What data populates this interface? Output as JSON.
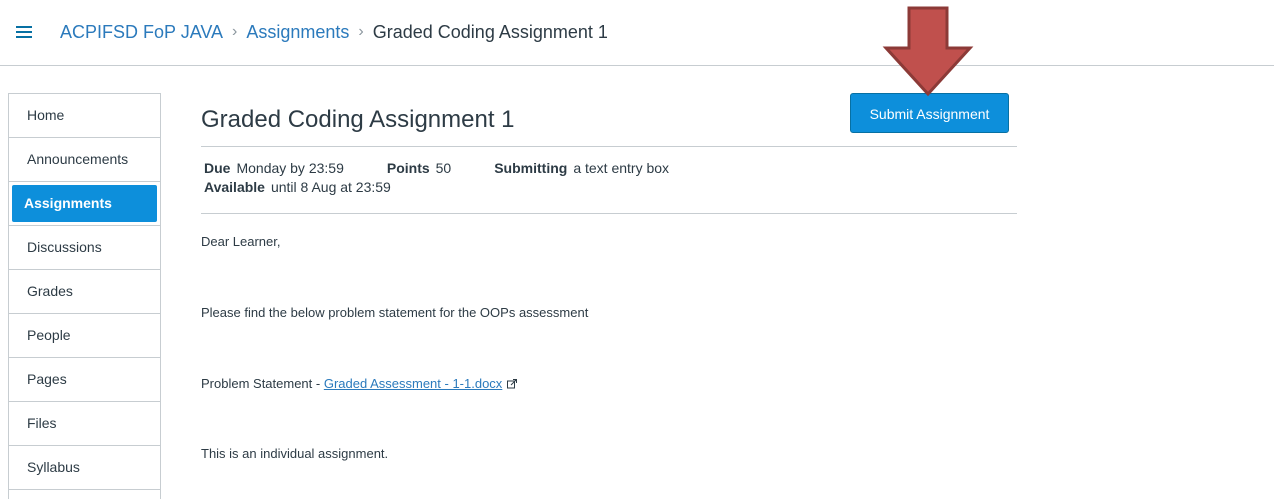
{
  "breadcrumb": {
    "course": "ACPIFSD FoP JAVA",
    "section": "Assignments",
    "current": "Graded Coding Assignment 1",
    "separator": "›"
  },
  "nav": {
    "items": [
      {
        "label": "Home",
        "active": false
      },
      {
        "label": "Announcements",
        "active": false
      },
      {
        "label": "Assignments",
        "active": true
      },
      {
        "label": "Discussions",
        "active": false
      },
      {
        "label": "Grades",
        "active": false
      },
      {
        "label": "People",
        "active": false
      },
      {
        "label": "Pages",
        "active": false
      },
      {
        "label": "Files",
        "active": false
      },
      {
        "label": "Syllabus",
        "active": false
      }
    ]
  },
  "assignment": {
    "title": "Graded Coding Assignment 1",
    "submit_label": "Submit Assignment",
    "due_label": "Due",
    "due_value": "Monday by 23:59",
    "points_label": "Points",
    "points_value": "50",
    "submitting_label": "Submitting",
    "submitting_value": "a text entry box",
    "available_label": "Available",
    "available_value": "until 8 Aug at 23:59"
  },
  "content": {
    "greeting": "Dear Learner,",
    "intro": "Please find the below problem statement for the OOPs assessment",
    "problem_prefix": "Problem Statement - ",
    "problem_link": "Graded Assessment - 1-1.docx",
    "note": "This is an individual assignment."
  },
  "colors": {
    "accent": "#0d8fdb",
    "link": "#2b7abc",
    "arrow": "#c0504d"
  },
  "icons": {
    "menu": "hamburger-icon",
    "external_link": "external-link-icon",
    "annotation": "down-arrow-icon"
  }
}
